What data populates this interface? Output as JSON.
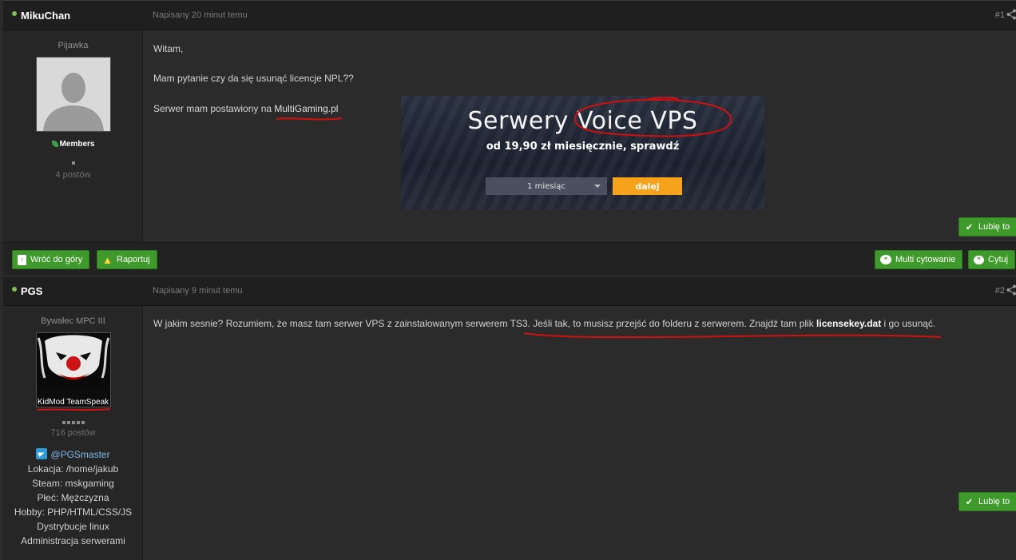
{
  "post1": {
    "author": "MikuChan",
    "date": "Napisany 20 minut temu",
    "number": "#1",
    "rank_title": "Pijawka",
    "group": "Members",
    "post_count": "4 postów",
    "lines": [
      "Witam,",
      "Mam pytanie czy da się usunąć licencje NPL??"
    ],
    "host_prefix": "Serwer mam postawiony na ",
    "host_link": "MultiGaming.pl",
    "like_label": "Lubię to"
  },
  "banner": {
    "headline": "Serwery Voice VPS",
    "sub": "od 19,90 zł miesięcznie, sprawdź",
    "select_value": "1 miesiąc",
    "go_label": "dalej"
  },
  "actions": {
    "back_to_top": "Wróć do góry",
    "report": "Raportuj",
    "multi_quote": "Multi cytowanie",
    "quote": "Cytuj"
  },
  "post2": {
    "author": "PGS",
    "date": "Napisany 9 minut temu",
    "number": "#2",
    "rank_title": "Bywalec MPC III",
    "group": "KidMod TeamSpeak",
    "post_count": "716 postów",
    "telegram": "@PGSmaster",
    "info": [
      "Lokacja: /home/jakub",
      "Steam: mskgaming",
      "Płeć: Mężczyzna",
      "Hobby: PHP/HTML/CSS/JS",
      "Dystrybucje linux",
      "Administracja serwerami"
    ],
    "body_a": "W jakim sesnie? Rozumiem, że masz tam serwer VPS z zainstalowanym serwerem TS3. Jeśli tak, to musisz przejść do folderu z serwerem. Znajdź tam plik ",
    "body_file": "licensekey.dat",
    "body_b": " i go usunąć.",
    "like_label": "Lubię to"
  },
  "colors": {
    "accent_green": "#3f9a2c",
    "online_dot": "#7fbf4d",
    "annotation_red": "#d01010",
    "banner_button": "#f6a21b"
  }
}
